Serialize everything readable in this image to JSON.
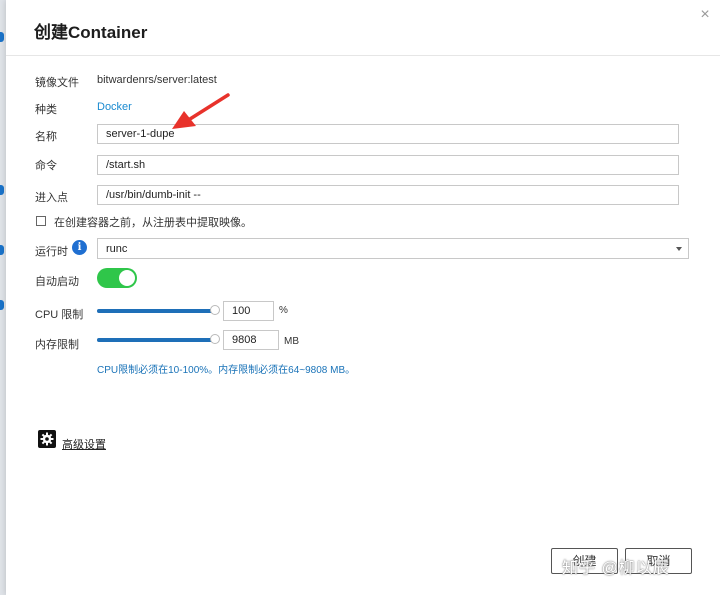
{
  "dialog": {
    "title": "创建Container"
  },
  "fields": {
    "image": {
      "label": "镜像文件",
      "value": "bitwardenrs/server:latest"
    },
    "type": {
      "label": "种类",
      "value": "Docker"
    },
    "name": {
      "label": "名称",
      "value": "server-1-dupe"
    },
    "command": {
      "label": "命令",
      "value": "/start.sh"
    },
    "entrypoint": {
      "label": "进入点",
      "value": "/usr/bin/dumb-init --"
    },
    "pull_checkbox": {
      "label": "在创建容器之前，从注册表中提取映像。",
      "checked": false
    },
    "runtime": {
      "label": "运行时",
      "value": "runc"
    },
    "autostart": {
      "label": "自动启动",
      "on": true
    },
    "cpu_limit": {
      "label": "CPU 限制",
      "value": "100",
      "unit": "%",
      "level": 1.0
    },
    "mem_limit": {
      "label": "内存限制",
      "value": "9808",
      "unit": "MB",
      "level": 1.0
    },
    "hint": "CPU限制必须在10-100%。内存限制必须在64~9808 MB。"
  },
  "advanced": {
    "label": "高级设置"
  },
  "buttons": {
    "create": "创建",
    "cancel": "取消"
  },
  "watermark": "知乎 @柳以辰",
  "colors": {
    "accent": "#1a73b8",
    "toggle_on": "#2fc64a",
    "annotation_arrow": "#e8322b"
  }
}
